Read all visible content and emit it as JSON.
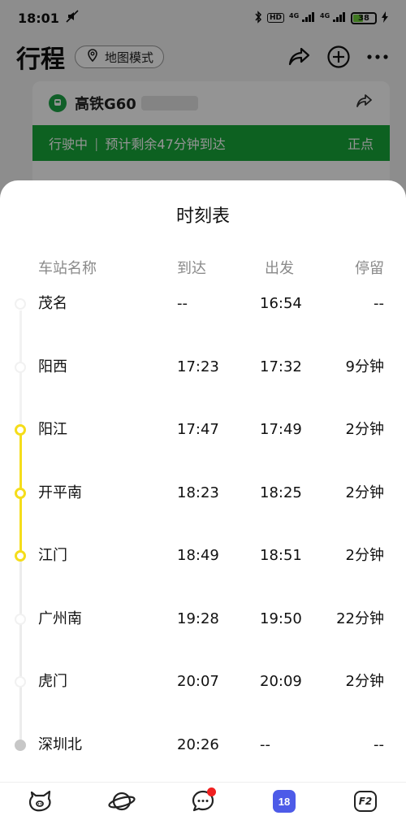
{
  "status_bar": {
    "time": "18:01",
    "battery": "38",
    "network_a": "HD",
    "network_b": "4G",
    "network_c": "4G"
  },
  "header": {
    "title": "行程",
    "map_mode_label": "地图模式"
  },
  "trip_card": {
    "train_label": "高铁G60",
    "status_text": "行驶中",
    "eta_text": "预计剩余47分钟到达",
    "ontime_text": "正点"
  },
  "sheet": {
    "title": "时刻表",
    "columns": {
      "station": "车站名称",
      "arrive": "到达",
      "depart": "出发",
      "stop": "停留"
    },
    "rows": [
      {
        "station": "茂名",
        "arrive": "--",
        "depart": "16:54",
        "stop": "--",
        "marker": "pale"
      },
      {
        "station": "阳西",
        "arrive": "17:23",
        "depart": "17:32",
        "stop": "9分钟",
        "marker": "pale"
      },
      {
        "station": "阳江",
        "arrive": "17:47",
        "depart": "17:49",
        "stop": "2分钟",
        "marker": "active"
      },
      {
        "station": "开平南",
        "arrive": "18:23",
        "depart": "18:25",
        "stop": "2分钟",
        "marker": "active"
      },
      {
        "station": "江门",
        "arrive": "18:49",
        "depart": "18:51",
        "stop": "2分钟",
        "marker": "active"
      },
      {
        "station": "广州南",
        "arrive": "19:28",
        "depart": "19:50",
        "stop": "22分钟",
        "marker": "pale"
      },
      {
        "station": "虎门",
        "arrive": "20:07",
        "depart": "20:09",
        "stop": "2分钟",
        "marker": "pale"
      },
      {
        "station": "深圳北",
        "arrive": "20:26",
        "depart": "--",
        "stop": "--",
        "marker": "end"
      }
    ]
  },
  "bottom_nav": {
    "calendar_day": "18",
    "f2_label": "F2"
  },
  "colors": {
    "accent_green": "#17a83a",
    "track_yellow": "#f5dd1b",
    "calendar_blue": "#4d5be8"
  }
}
